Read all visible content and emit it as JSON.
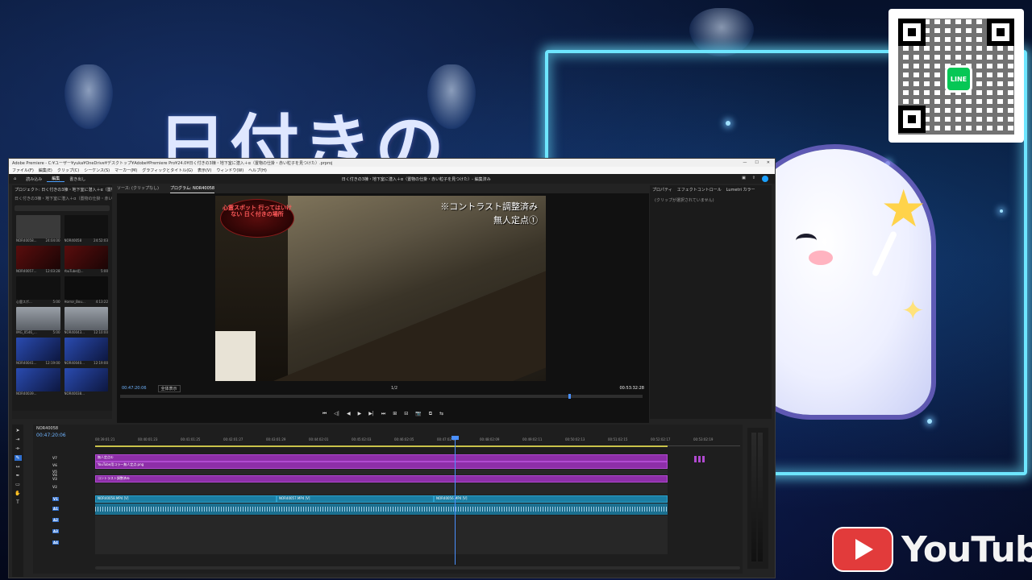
{
  "background": {
    "title_text": "日付きの",
    "qr_logo": "LINE",
    "youtube_text": "YouTube",
    "accent_color": "#6ee6ff"
  },
  "window": {
    "title": "Adobe Premiere - C:¥ユーザー¥yuka¥OneDrive¥デスクトップ¥Adobe¥Premiere Pro¥24.0¥日く付きの3棟・地下室に潜入＋α（置物の仕掛・赤い粒子を見つけた）.prproj",
    "menu": [
      "ファイル(F)",
      "編集(E)",
      "クリップ(C)",
      "シーケンス(S)",
      "マーカー(M)",
      "グラフィックとタイトル(G)",
      "表示(V)",
      "ウィンドウ(W)",
      "ヘルプ(H)"
    ],
    "tabs": [
      "読み込み",
      "編集",
      "書き出し"
    ],
    "center_title": "日く付きの3棟・地下室に潜入＋α（置物の仕掛・赤い粒子を見つけた）- 編集済み",
    "window_buttons": [
      "—",
      "☐",
      "✕"
    ]
  },
  "project": {
    "tab": "プロジェクト: 日く付きの3棟・地下室に潜入＋α（置物の仕掛…",
    "path": "日く付きの3棟・地下室に潜入＋α（置物の仕掛・赤い粒子を見つけた）.prproj",
    "items": [
      {
        "name": "NOR40058...",
        "dur": "24:04:00",
        "style": ""
      },
      {
        "name": "NOR40058",
        "dur": "24:52:03",
        "style": "dark"
      },
      {
        "name": "NOR40057...",
        "dur": "12:03:28",
        "style": "red"
      },
      {
        "name": "YouTube用...",
        "dur": "5:00",
        "style": "red"
      },
      {
        "name": "心霊スポ...",
        "dur": "5:00",
        "style": "dark"
      },
      {
        "name": "Horror_Bou...",
        "dur": "4:13:22",
        "style": "green"
      },
      {
        "name": "IMG_0546_...",
        "dur": "5:00",
        "style": "build"
      },
      {
        "name": "NOR40043...",
        "dur": "12:10:00",
        "style": "build"
      },
      {
        "name": "NOR40041...",
        "dur": "12:19:00",
        "style": "blue"
      },
      {
        "name": "NOR40040...",
        "dur": "12:19:00",
        "style": "blue"
      },
      {
        "name": "NOR40039...",
        "dur": "",
        "style": "blue"
      },
      {
        "name": "NOR40038...",
        "dur": "",
        "style": "blue"
      }
    ]
  },
  "monitor": {
    "source_tab": "ソース: (クリップなし)",
    "program_tab": "プログラム: NOR40058",
    "seal_text": "心霊スポット 行ってはいけない 日く付きの場所",
    "caption_line1": "※コントラスト調整済み",
    "caption_line2": "無人定点①",
    "timecode_current": "00:47:20:06",
    "fit": "全体表示",
    "resolution": "1/2",
    "timecode_total": "00:53:32:28",
    "transport": [
      "⏮",
      "◁|",
      "◀",
      "▶",
      "▶|",
      "⏭",
      "⊞",
      "⊟",
      "📷",
      "⧉",
      "⇆"
    ]
  },
  "effects": {
    "tabs": [
      "プロパティ",
      "エフェクトコントロール",
      "Lumetri カラー"
    ],
    "message": "(クリップが選択されていません)"
  },
  "timeline": {
    "sequence_tab": "NOR40058",
    "timecode": "00:47:20:06",
    "ruler": [
      "00:39:01:21",
      "00:40:01:23",
      "00:41:01:25",
      "00:42:01:27",
      "00:43:01:29",
      "00:44:02:01",
      "00:45:02:03",
      "00:46:02:05",
      "00:47:02:07",
      "00:48:02:09",
      "00:49:02:11",
      "00:50:02:13",
      "00:51:02:15",
      "00:52:02:17",
      "00:53:02:19"
    ],
    "video_tracks": [
      "V7",
      "V6",
      "V5",
      "V4",
      "V3",
      "V2",
      "V1"
    ],
    "audio_tracks": [
      "A1",
      "A2",
      "A3",
      "A4"
    ],
    "clips": {
      "v7": "無人定点①",
      "v6": "YouTube用コラー無人定点.png",
      "v3": "コントラスト調整済み",
      "v1a": "NOR40058.MP4 [V]",
      "v1b": "NOR40057.MP4 [V]",
      "v1c": "NOR40056.MP4 [V]"
    },
    "meter_db": [
      "0",
      "-6",
      "-12",
      "-18",
      "-24",
      "-30",
      "-36",
      "-42",
      "-48",
      "-54"
    ]
  }
}
